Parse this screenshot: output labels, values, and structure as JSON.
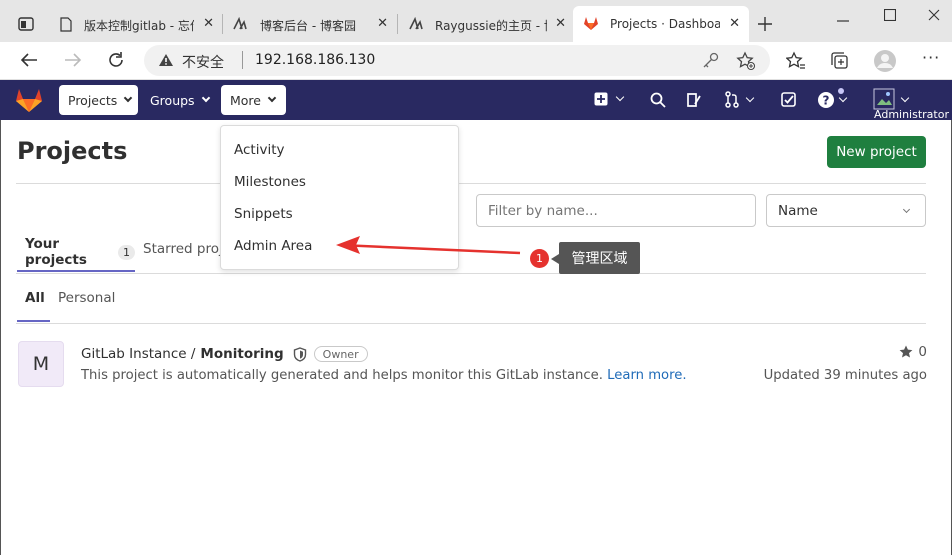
{
  "browser": {
    "tabs": [
      {
        "title": "版本控制gitlab - 忘作"
      },
      {
        "title": "博客后台 - 博客园"
      },
      {
        "title": "Raygussie的主页 - 博"
      },
      {
        "title": "Projects · Dashboard"
      }
    ],
    "new_tab_icon": "plus-icon",
    "insecure_label": "不安全",
    "url": "192.168.186.130"
  },
  "navbar": {
    "projects_label": "Projects",
    "groups_label": "Groups",
    "more_label": "More",
    "user_label": "Administrator"
  },
  "more_menu": {
    "items": [
      {
        "label": "Activity"
      },
      {
        "label": "Milestones"
      },
      {
        "label": "Snippets"
      },
      {
        "label": "Admin Area"
      }
    ]
  },
  "page": {
    "title": "Projects",
    "new_project_label": "New project",
    "filter_placeholder": "Filter by name...",
    "sort_value": "Name",
    "tabs": {
      "your_projects": "Your projects",
      "your_projects_count": "1",
      "starred": "Starred proje"
    },
    "subtabs": {
      "all": "All",
      "personal": "Personal"
    }
  },
  "project": {
    "avatar_letter": "M",
    "namespace": "GitLab Instance /",
    "name": "Monitoring",
    "role": "Owner",
    "description": "This project is automatically generated and helps monitor this GitLab instance.",
    "learn_more": "Learn more.",
    "stars": "0",
    "updated": "Updated 39 minutes ago"
  },
  "annotation": {
    "step": "1",
    "label": "管理区域"
  },
  "colors": {
    "navbar": "#292961",
    "new_project": "#1f7f3f",
    "link": "#1f6bb8",
    "annotation_arrow": "#e5322e",
    "avatar_bg": "#f1eaf8"
  }
}
